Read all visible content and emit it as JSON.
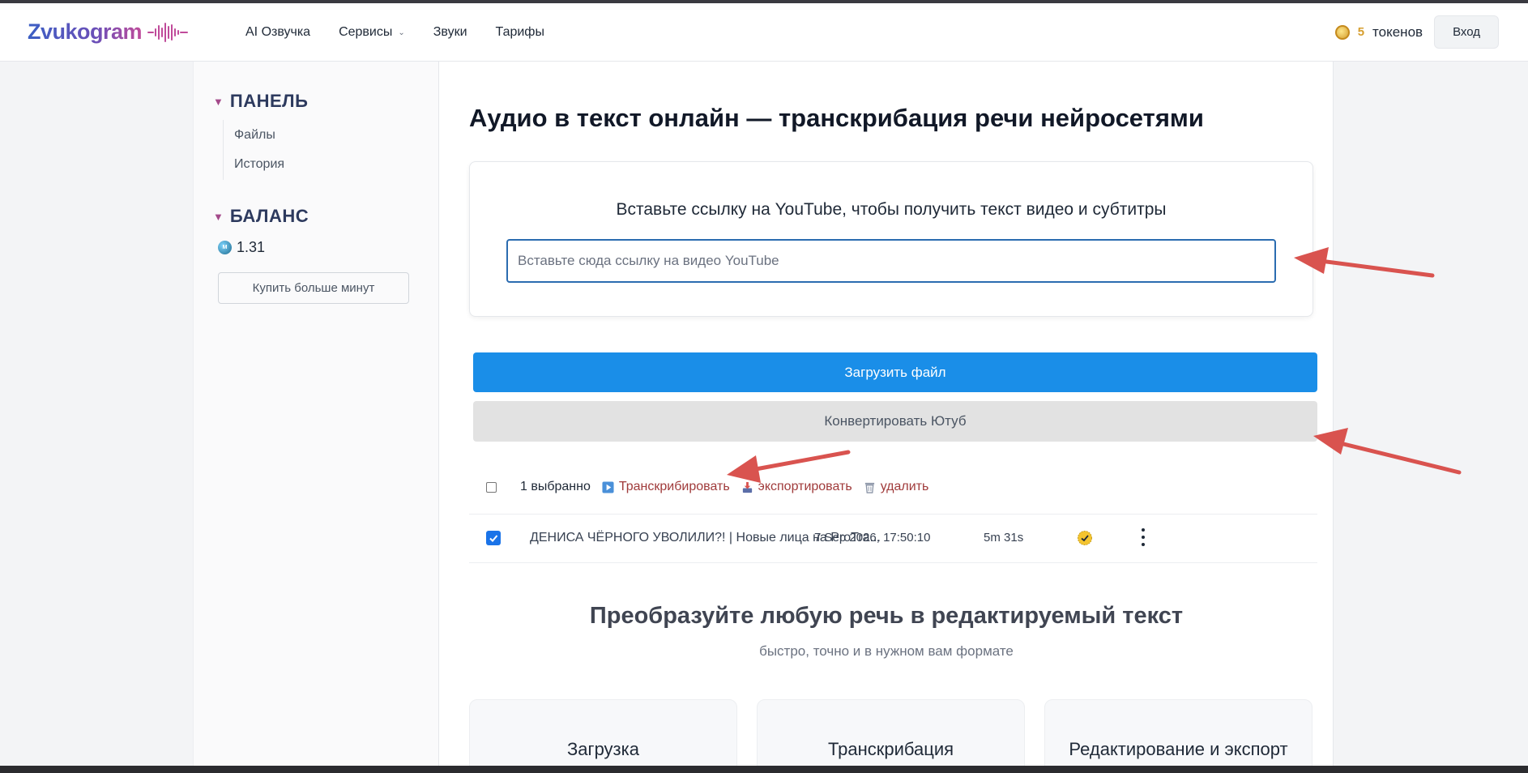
{
  "header": {
    "logo": "Zvukogram",
    "nav": [
      {
        "label": "AI Озвучка",
        "dropdown": false
      },
      {
        "label": "Сервисы",
        "dropdown": true
      },
      {
        "label": "Звуки",
        "dropdown": false
      },
      {
        "label": "Тарифы",
        "dropdown": false
      }
    ],
    "tokens": {
      "count": "5",
      "label": "токенов"
    },
    "login_label": "Вход"
  },
  "sidebar": {
    "panel_title": "ПАНЕЛЬ",
    "panel_links": [
      "Файлы",
      "История"
    ],
    "balance_title": "БАЛАНС",
    "balance_value": "1.31",
    "buy_label": "Купить больше минут"
  },
  "main": {
    "title": "Аудио в текст онлайн — транскрибация речи нейросетями",
    "youtube": {
      "heading": "Вставьте ссылку на YouTube, чтобы получить текст видео и субтитры",
      "placeholder": "Вставьте сюда ссылку на видео YouTube",
      "value": ""
    },
    "upload_label": "Загрузить файл",
    "convert_label": "Конвертировать Ютуб",
    "toolbar": {
      "selected": "1 выбранно",
      "transcribe": "Транскрибировать",
      "export": "экспортировать",
      "delete": "удалить"
    },
    "files": [
      {
        "name": "ДЕНИСА ЧЁРНОГО УВОЛИЛИ?! | Новые лица на ProTra...",
        "date": "7 Sep 2026, 17:50:10",
        "duration": "5m 31s",
        "checked": true,
        "status": "done"
      }
    ],
    "promo": {
      "title": "Преобразуйте любую речь в редактируемый текст",
      "subtitle": "быстро, точно и в нужном вам формате"
    },
    "features": [
      "Загрузка",
      "Транскрибация",
      "Редактирование и экспорт"
    ]
  },
  "colors": {
    "primary": "#1a8ee8",
    "secondary_button": "#e2e2e2",
    "action_link": "#a03b3b",
    "annotation_arrow": "#d9534f",
    "token_gold": "#d69e2e"
  }
}
